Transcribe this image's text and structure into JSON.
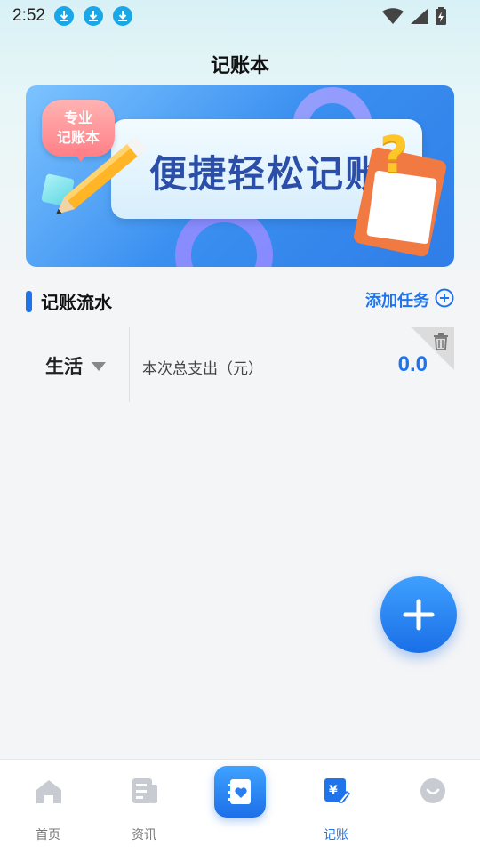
{
  "status_bar": {
    "time": "2:52",
    "download_icons": [
      "download-icon",
      "download-icon",
      "download-icon"
    ],
    "right_icons": [
      "wifi-icon",
      "signal-icon",
      "battery-icon"
    ]
  },
  "header": {
    "title": "记账本"
  },
  "banner": {
    "badge_text": "专业\n记账本",
    "headline": "便捷轻松记账"
  },
  "section": {
    "title": "记账流水",
    "add_label": "添加任务"
  },
  "record": {
    "category": "生活",
    "description": "本次总支出（元）",
    "amount": "0.0"
  },
  "bottom_nav": {
    "items": [
      {
        "label": "首页",
        "icon": "home-icon"
      },
      {
        "label": "资讯",
        "icon": "news-icon"
      },
      {
        "label": "",
        "icon": "notebook-heart-icon"
      },
      {
        "label": "记账",
        "icon": "ledger-edit-icon"
      },
      {
        "label": "",
        "icon": "profile-icon"
      }
    ]
  },
  "colors": {
    "accent": "#1f74ec",
    "page_bg": "#f4f5f7"
  }
}
